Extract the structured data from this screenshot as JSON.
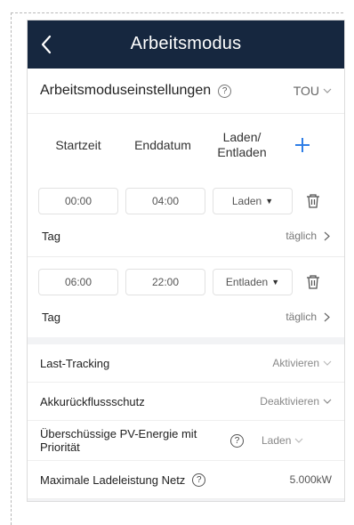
{
  "header": {
    "title": "Arbeitsmodus"
  },
  "mode_settings": {
    "label": "Arbeitsmoduseinstellungen",
    "value": "TOU"
  },
  "columns": {
    "start": "Startzeit",
    "end": "Enddatum",
    "action": "Laden/\nEntladen"
  },
  "slots": [
    {
      "start": "00:00",
      "end": "04:00",
      "mode": "Laden",
      "day_label": "Tag",
      "day_value": "täglich"
    },
    {
      "start": "06:00",
      "end": "22:00",
      "mode": "Entladen",
      "day_label": "Tag",
      "day_value": "täglich"
    }
  ],
  "settings": {
    "load_tracking": {
      "label": "Last-Tracking",
      "value": "Aktivieren"
    },
    "backflow": {
      "label": "Akkurückflussschutz",
      "value": "Deaktivieren"
    },
    "pv_priority": {
      "label": "Überschüssige PV-Energie mit Priorität",
      "value": "Laden"
    },
    "max_charge": {
      "label": "Maximale Ladeleistung Netz",
      "value": "5.000kW"
    }
  },
  "colors": {
    "header_bg": "#16273f",
    "accent": "#2f7ee6"
  }
}
